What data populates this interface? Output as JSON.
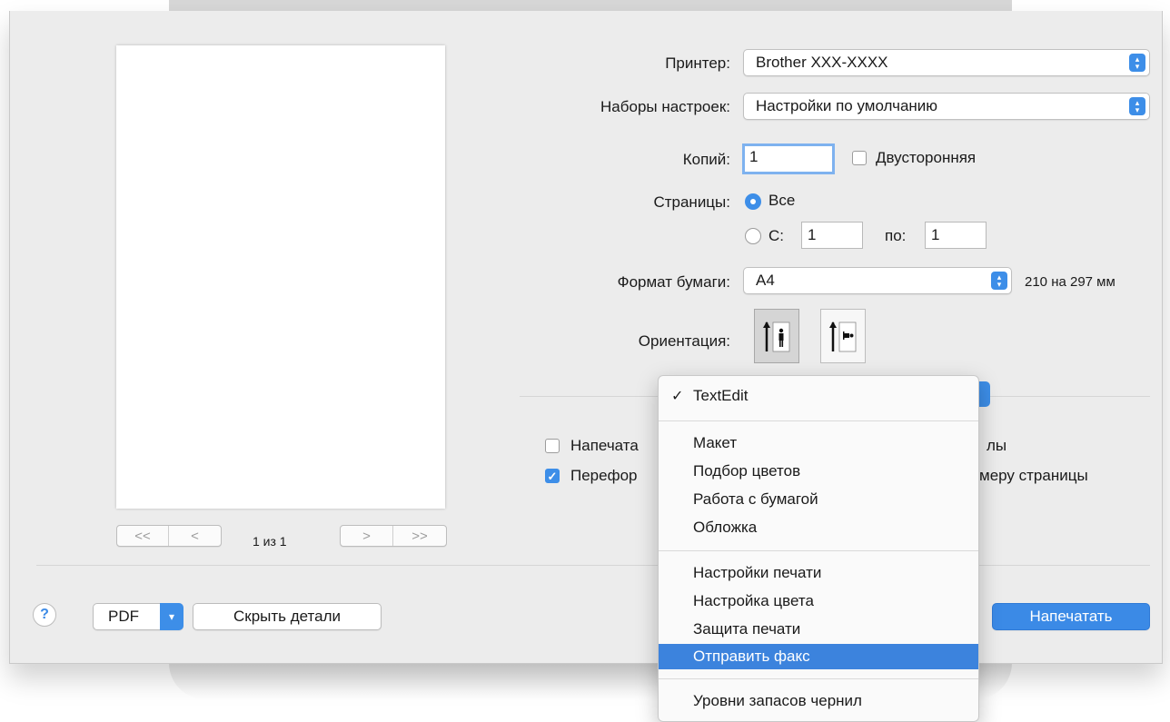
{
  "preview": {
    "page_indicator": "1 из 1",
    "nav_first": "<<",
    "nav_prev": "<",
    "nav_next": ">",
    "nav_last": ">>"
  },
  "printer": {
    "label": "Принтер:",
    "value": "Brother XXX-XXXX"
  },
  "presets": {
    "label": "Наборы настроек:",
    "value": "Настройки по умолчанию"
  },
  "copies": {
    "label": "Копий:",
    "value": "1",
    "duplex_label": "Двусторонняя",
    "duplex_checked": false
  },
  "pages": {
    "label": "Страницы:",
    "all_label": "Все",
    "from_label": "С:",
    "from_value": "1",
    "to_label": "по:",
    "to_value": "1",
    "selected": "all"
  },
  "paper": {
    "label": "Формат бумаги:",
    "value": "A4",
    "dimensions": "210 на 297 мм"
  },
  "orientation": {
    "label": "Ориентация:",
    "selected": "portrait"
  },
  "options": {
    "opt1_label_visible": "Напечата",
    "opt1_label_tail": "лы",
    "opt1_checked": false,
    "opt2_label_visible": "Перефор",
    "opt2_label_tail": "меру страницы",
    "opt2_checked": true
  },
  "menu": {
    "items": [
      {
        "label": "TextEdit",
        "checked": true
      },
      {
        "label": "Макет"
      },
      {
        "label": "Подбор цветов"
      },
      {
        "label": "Работа с бумагой"
      },
      {
        "label": "Обложка"
      },
      {
        "label": "Настройки печати"
      },
      {
        "label": "Настройка цвета"
      },
      {
        "label": "Защита печати"
      },
      {
        "label": "Отправить факс",
        "highlighted": true
      },
      {
        "label": "Уровни запасов чернил"
      }
    ]
  },
  "footer": {
    "help_label": "?",
    "pdf_label": "PDF",
    "hide_details_label": "Скрыть детали",
    "print_label": "Напечатать"
  },
  "colors": {
    "accent": "#3d8ee8",
    "highlight": "#3c83dd",
    "window_bg": "#ececec"
  }
}
